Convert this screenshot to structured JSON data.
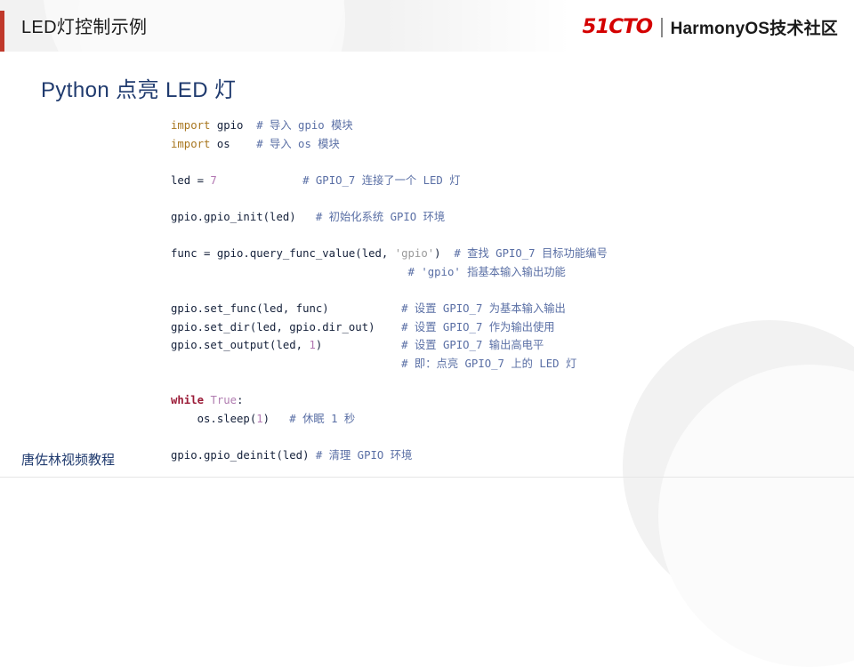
{
  "header": {
    "title": "LED灯控制示例",
    "brand_mark": "51CTO",
    "brand_divider": "|",
    "brand_name": "HarmonyOS技术社区",
    "accent_color": "#c0392b",
    "band_color": "#f2f2f2"
  },
  "section": {
    "heading": "Python 点亮 LED 灯",
    "heading_color": "#1f3a6e"
  },
  "code": {
    "language": "python",
    "colors": {
      "keyword": "#a8761f",
      "control_keyword": "#9b1b37",
      "number": "#b277b2",
      "literal": "#b07cb0",
      "string": "#9a9a9a",
      "comment": "#5a6fa5",
      "identifier": "#14203a"
    },
    "lines": [
      {
        "tokens": [
          {
            "t": "import",
            "c": "kw"
          },
          {
            "t": " gpio  ",
            "c": "id"
          },
          {
            "t": "# 导入 gpio 模块",
            "c": "cmt"
          }
        ]
      },
      {
        "tokens": [
          {
            "t": "import",
            "c": "kw"
          },
          {
            "t": " os    ",
            "c": "id"
          },
          {
            "t": "# 导入 os 模块",
            "c": "cmt"
          }
        ]
      },
      {
        "tokens": []
      },
      {
        "tokens": [
          {
            "t": "led = ",
            "c": "id"
          },
          {
            "t": "7",
            "c": "num"
          },
          {
            "t": "             ",
            "c": "id"
          },
          {
            "t": "# GPIO_7 连接了一个 LED 灯",
            "c": "cmt"
          }
        ]
      },
      {
        "tokens": []
      },
      {
        "tokens": [
          {
            "t": "gpio.gpio_init(led)   ",
            "c": "id"
          },
          {
            "t": "# 初始化系统 GPIO 环境",
            "c": "cmt"
          }
        ]
      },
      {
        "tokens": []
      },
      {
        "tokens": [
          {
            "t": "func = gpio.query_func_value(led, ",
            "c": "id"
          },
          {
            "t": "'gpio'",
            "c": "str"
          },
          {
            "t": ")  ",
            "c": "id"
          },
          {
            "t": "# 查找 GPIO_7 目标功能编号",
            "c": "cmt"
          }
        ]
      },
      {
        "tokens": [
          {
            "t": "                                    ",
            "c": "id"
          },
          {
            "t": "# 'gpio' 指基本输入输出功能",
            "c": "cmt"
          }
        ]
      },
      {
        "tokens": []
      },
      {
        "tokens": [
          {
            "t": "gpio.set_func(led, func)           ",
            "c": "id"
          },
          {
            "t": "# 设置 GPIO_7 为基本输入输出",
            "c": "cmt"
          }
        ]
      },
      {
        "tokens": [
          {
            "t": "gpio.set_dir(led, gpio.dir_out)    ",
            "c": "id"
          },
          {
            "t": "# 设置 GPIO_7 作为输出使用",
            "c": "cmt"
          }
        ]
      },
      {
        "tokens": [
          {
            "t": "gpio.set_output(led, ",
            "c": "id"
          },
          {
            "t": "1",
            "c": "num"
          },
          {
            "t": ")            ",
            "c": "id"
          },
          {
            "t": "# 设置 GPIO_7 输出高电平",
            "c": "cmt"
          }
        ]
      },
      {
        "tokens": [
          {
            "t": "                                   ",
            "c": "id"
          },
          {
            "t": "# 即：点亮 GPIO_7 上的 LED 灯",
            "c": "cmt"
          }
        ]
      },
      {
        "tokens": []
      },
      {
        "tokens": [
          {
            "t": "while",
            "c": "kw2"
          },
          {
            "t": " ",
            "c": "id"
          },
          {
            "t": "True",
            "c": "lit"
          },
          {
            "t": ":",
            "c": "id"
          }
        ]
      },
      {
        "tokens": [
          {
            "t": "    os.sleep(",
            "c": "id"
          },
          {
            "t": "1",
            "c": "num"
          },
          {
            "t": ")   ",
            "c": "id"
          },
          {
            "t": "# 休眠 1 秒",
            "c": "cmt"
          }
        ]
      },
      {
        "tokens": []
      },
      {
        "tokens": [
          {
            "t": "gpio.gpio_deinit(led) ",
            "c": "id"
          },
          {
            "t": "# 清理 GPIO 环境",
            "c": "cmt"
          }
        ]
      }
    ]
  },
  "footer": {
    "text": "唐佐林视频教程",
    "text_color": "#1f3a6e"
  }
}
